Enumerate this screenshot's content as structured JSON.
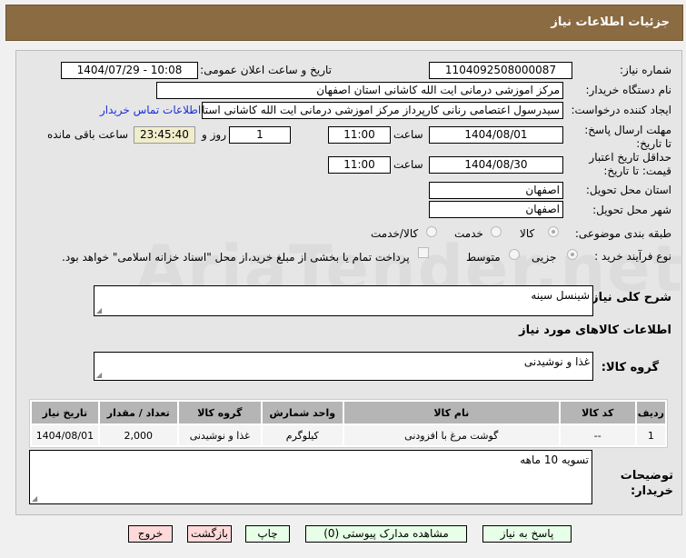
{
  "header": {
    "title": "جزئیات اطلاعات نیاز"
  },
  "watermark": "AriaTender.net",
  "form": {
    "need_number_label": "شماره نیاز:",
    "need_number": "1104092508000087",
    "announce_label": "تاریخ و ساعت اعلان عمومی:",
    "announce_value": "1404/07/29 - 10:08",
    "buyer_label": "نام دستگاه خریدار:",
    "buyer": "مرکز اموزشی درمانی ایت الله کاشانی استان اصفهان",
    "creator_label": "ایجاد کننده درخواست:",
    "creator": "سیدرسول اعتصامی رنانی کارپرداز مرکز اموزشی درمانی ایت الله کاشانی استان",
    "contact_link": "اطلاعات تماس خریدار",
    "deadline_label": "مهلت ارسال پاسخ: تا تاریخ:",
    "deadline_date": "1404/08/01",
    "time_label": "ساعت",
    "deadline_time": "11:00",
    "days": "1",
    "days_label": "روز و",
    "remaining": "23:45:40",
    "remaining_label": "ساعت باقی مانده",
    "validity_label": "حداقل تاریخ اعتبار قیمت: تا تاریخ:",
    "validity_date": "1404/08/30",
    "validity_time": "11:00",
    "province_label": "استان محل تحویل:",
    "province": "اصفهان",
    "city_label": "شهر محل تحویل:",
    "city": "اصفهان",
    "category_label": "طبقه بندی موضوعی:",
    "category_options": [
      "کالا",
      "خدمت",
      "کالا/خدمت"
    ],
    "category_selected": "کالا",
    "process_label": "نوع فرآیند خرید :",
    "process_options": [
      "جزیی",
      "متوسط"
    ],
    "process_selected": "جزیی",
    "payment_note": "پرداخت تمام یا بخشی از مبلغ خرید،از محل \"اسناد خزانه اسلامی\" خواهد بود.",
    "summary_label": "شرح کلی نیاز:",
    "summary": "شینسل سینه",
    "goods_heading": "اطلاعات کالاهای مورد نیاز",
    "goods_group_label": "گروه کالا:",
    "goods_group": "غذا و نوشیدنی",
    "notes_label": "توضیحات خریدار:",
    "notes": "تسویه 10 ماهه"
  },
  "table": {
    "headers": [
      "ردیف",
      "کد کالا",
      "نام کالا",
      "واحد شمارش",
      "گروه کالا",
      "تعداد / مقدار",
      "تاریخ نیاز"
    ],
    "rows": [
      [
        "1",
        "--",
        "گوشت مرغ با افزودنی",
        "کیلوگرم",
        "غذا و نوشیدنی",
        "2,000",
        "1404/08/01"
      ]
    ]
  },
  "buttons": {
    "reply": "پاسخ به نیاز",
    "docs": "مشاهده مدارک پیوستی (0)",
    "print": "چاپ",
    "back": "بازگشت",
    "exit": "خروج"
  }
}
